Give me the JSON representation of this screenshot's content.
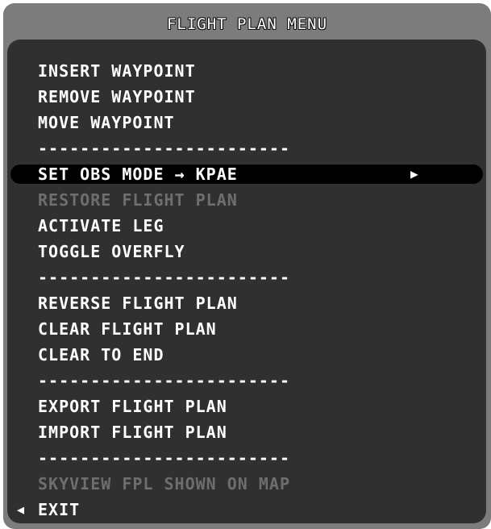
{
  "title": "FLIGHT PLAN MENU",
  "menu": {
    "items": [
      {
        "label": "INSERT WAYPOINT",
        "state": "enabled"
      },
      {
        "label": "REMOVE WAYPOINT",
        "state": "enabled"
      },
      {
        "label": "MOVE WAYPOINT",
        "state": "enabled"
      },
      {
        "label": "------------------------",
        "state": "separator"
      },
      {
        "label": "SET OBS MODE → KPAE",
        "state": "selected",
        "submenu_arrow": "▶"
      },
      {
        "label": "RESTORE FLIGHT PLAN",
        "state": "disabled"
      },
      {
        "label": "ACTIVATE LEG",
        "state": "enabled"
      },
      {
        "label": "TOGGLE OVERFLY",
        "state": "enabled"
      },
      {
        "label": "------------------------",
        "state": "separator"
      },
      {
        "label": "REVERSE FLIGHT PLAN",
        "state": "enabled"
      },
      {
        "label": "CLEAR FLIGHT PLAN",
        "state": "enabled"
      },
      {
        "label": "CLEAR TO END",
        "state": "enabled"
      },
      {
        "label": "------------------------",
        "state": "separator"
      },
      {
        "label": "EXPORT FLIGHT PLAN",
        "state": "enabled"
      },
      {
        "label": "IMPORT FLIGHT PLAN",
        "state": "enabled"
      },
      {
        "label": "------------------------",
        "state": "separator"
      },
      {
        "label": "SKYVIEW FPL SHOWN ON MAP",
        "state": "disabled"
      },
      {
        "label": "EXIT",
        "state": "enabled",
        "back_arrow": "◀"
      }
    ]
  },
  "colors": {
    "frame": "#7c7c7c",
    "panel": "#303030",
    "text": "#ffffff",
    "disabled_text": "#6e6e6e",
    "selection": "#000000"
  }
}
